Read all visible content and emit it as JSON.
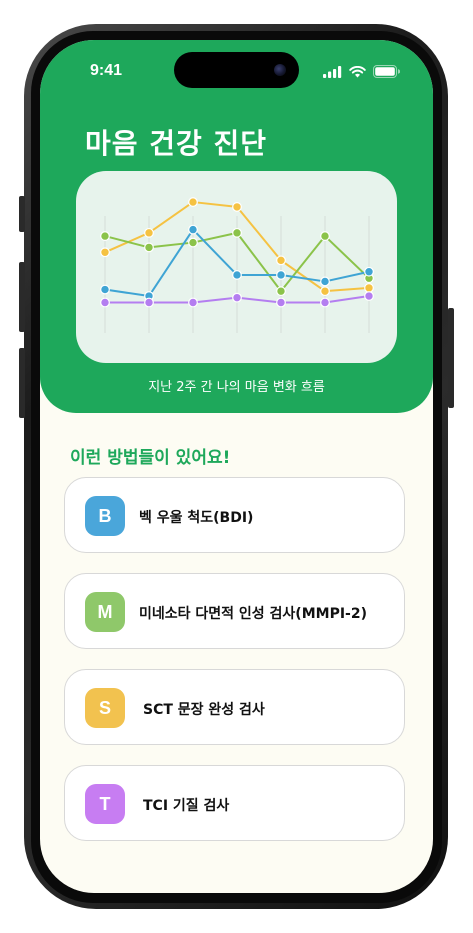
{
  "status_bar": {
    "time": "9:41"
  },
  "header": {
    "title": "마음 건강 진단",
    "caption": "지난 2주 간 나의 마음 변화 흐름",
    "color": "#1ea85b"
  },
  "chart_data": {
    "type": "line",
    "x": [
      1,
      2,
      3,
      4,
      5,
      6,
      7
    ],
    "ylim": [
      0,
      1
    ],
    "grid": "vertical",
    "series": [
      {
        "color": "#f5c242",
        "values": [
          0.56,
          0.68,
          0.87,
          0.84,
          0.51,
          0.32,
          0.34
        ]
      },
      {
        "color": "#8bc34a",
        "values": [
          0.66,
          0.59,
          0.62,
          0.68,
          0.32,
          0.66,
          0.4
        ]
      },
      {
        "color": "#3fa4d4",
        "values": [
          0.33,
          0.29,
          0.7,
          0.42,
          0.42,
          0.38,
          0.44
        ]
      },
      {
        "color": "#b47ef0",
        "values": [
          0.25,
          0.25,
          0.25,
          0.28,
          0.25,
          0.25,
          0.29
        ]
      }
    ]
  },
  "section": {
    "title": "이런 방법들이 있어요!"
  },
  "methods": [
    {
      "letter": "B",
      "label": "벡 우울 척도(BDI)",
      "color": "#4aa6da"
    },
    {
      "letter": "M",
      "label": "미네소타 다면적 인성 검사(MMPI-2)",
      "color": "#8fc86a"
    },
    {
      "letter": "S",
      "label": "SCT 문장 완성 검사",
      "color": "#f2c24f"
    },
    {
      "letter": "T",
      "label": "TCI 기질 검사",
      "color": "#c77df2"
    }
  ]
}
